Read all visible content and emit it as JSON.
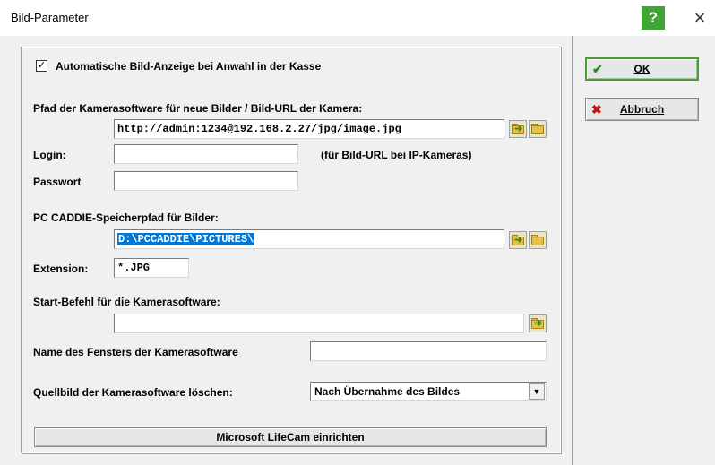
{
  "window": {
    "title": "Bild-Parameter",
    "help_label": "?",
    "close_label": "×"
  },
  "auto_display": {
    "checked": true,
    "check_glyph": "✓",
    "label": "Automatische Bild-Anzeige bei Anwahl in der Kasse"
  },
  "camera_path": {
    "label": "Pfad der Kamerasoftware für neue Bilder / Bild-URL der Kamera:",
    "value": "http://admin:1234@192.168.2.27/jpg/image.jpg"
  },
  "login": {
    "label": "Login:",
    "value": "",
    "hint": "(für Bild-URL bei IP-Kameras)"
  },
  "password": {
    "label": "Passwort",
    "value": ""
  },
  "storage_path": {
    "label": "PC CADDIE-Speicherpfad für Bilder:",
    "value": "D:\\PCCADDIE\\PICTURES\\"
  },
  "extension": {
    "label": "Extension:",
    "value": "*.JPG"
  },
  "start_command": {
    "label": "Start-Befehl für die Kamerasoftware:",
    "value": ""
  },
  "window_name": {
    "label": "Name des Fensters der Kamerasoftware",
    "value": ""
  },
  "delete_source": {
    "label": "Quellbild der Kamerasoftware löschen:",
    "selected": "Nach Übernahme des Bildes"
  },
  "lifecam_button": {
    "label": "Microsoft LifeCam einrichten"
  },
  "ok_button": {
    "label": "OK",
    "icon": "✔"
  },
  "cancel_button": {
    "label": "Abbruch",
    "icon": "✖"
  },
  "colors": {
    "accent_green": "#3fa535",
    "selection_blue": "#0078d7",
    "cancel_red": "#cc1010"
  }
}
